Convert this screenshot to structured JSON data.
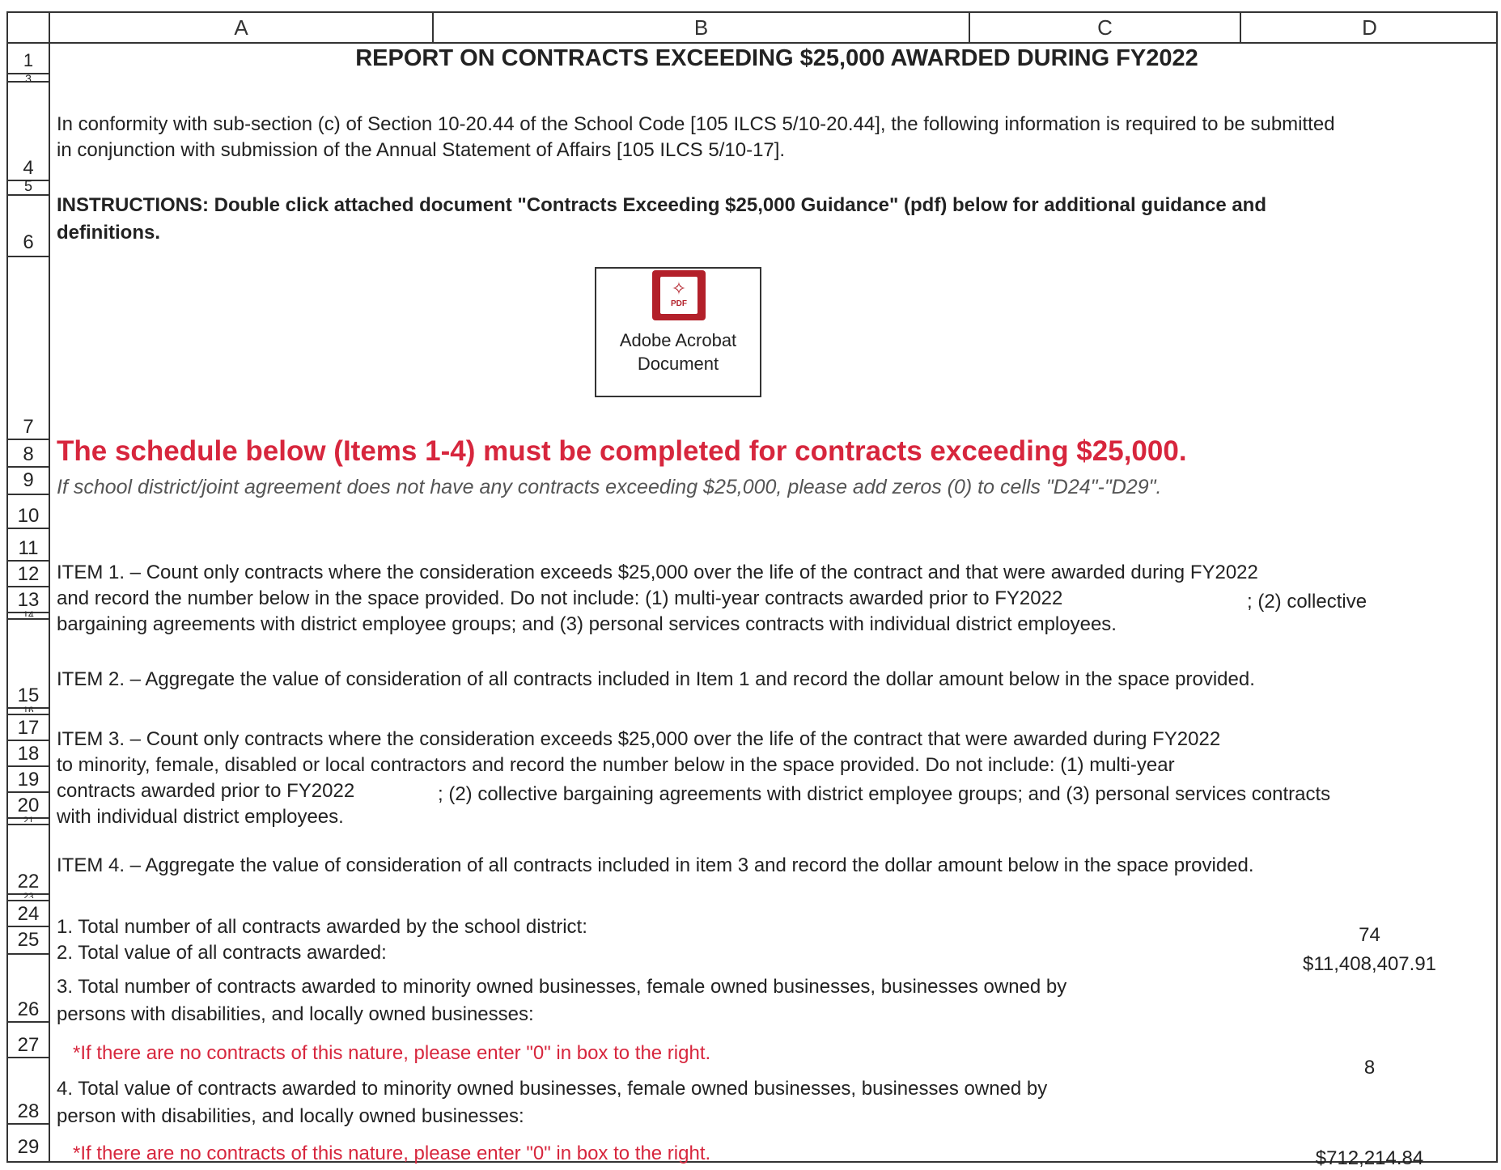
{
  "columns": {
    "a": "A",
    "b": "B",
    "c": "C",
    "d": "D"
  },
  "row_numbers": {
    "r1": "1",
    "r3": "3",
    "r4": "4",
    "r5": "5",
    "r6": "6",
    "r7": "7",
    "r8": "8",
    "r9": "9",
    "r10": "10",
    "r11": "11",
    "r12": "12",
    "r13": "13",
    "r14": "14",
    "r15": "15",
    "r16": "16",
    "r17": "17",
    "r18": "18",
    "r19": "19",
    "r20": "20",
    "r21": "21",
    "r22": "22",
    "r23": "23",
    "r24": "24",
    "r25": "25",
    "r26": "26",
    "r27": "27",
    "r28": "28",
    "r29": "29"
  },
  "title": "REPORT ON CONTRACTS EXCEEDING $25,000 AWARDED DURING FY2022",
  "conformity_line1": "In conformity with sub-section (c) of Section 10-20.44 of the School Code [105 ILCS 5/10-20.44], the following information is required to be submitted",
  "conformity_line2": "in conjunction with submission of the Annual Statement of Affairs [105 ILCS 5/10-17].",
  "instructions_line1": "INSTRUCTIONS:  Double click attached document \"Contracts Exceeding $25,000 Guidance\" (pdf) below for additional guidance and",
  "instructions_line2": "definitions.",
  "attachment": {
    "icon": "pdf-icon",
    "badge": "PDF",
    "caption_line1": "Adobe Acrobat",
    "caption_line2": "Document"
  },
  "schedule_heading": "The schedule below (Items 1-4) must be completed for contracts exceeding $25,000.",
  "schedule_note": "If school district/joint agreement does not have any contracts exceeding $25,000, please add zeros (0) to cells \"D24\"-\"D29\".",
  "item1_line1": "ITEM 1. – Count only contracts where the consideration exceeds $25,000 over the life of the contract and that were awarded during FY2022",
  "item1_line2": "and record the number below in the space provided. Do not include: (1) multi-year contracts awarded prior to FY2022",
  "item1_line2b": "; (2) collective",
  "item1_line3": "bargaining agreements with district employee groups; and (3) personal services contracts with individual district employees.",
  "item2": "ITEM 2. – Aggregate the value of consideration of all contracts included in Item 1 and record the dollar amount below in the space provided.",
  "item3_line1": "ITEM 3. – Count only contracts where the consideration exceeds $25,000 over the life of the contract that were awarded during FY2022",
  "item3_line2": "to minority, female, disabled or local contractors and record the number below in the space provided. Do not include: (1) multi-year",
  "item3_line3": "contracts awarded prior to FY2022",
  "item3_line3b": "; (2) collective bargaining agreements with district employee groups; and (3) personal services contracts",
  "item3_line4": "with individual district employees.",
  "item4": "ITEM 4. – Aggregate the value of consideration of all contracts included in item 3 and record the dollar amount below in the space provided.",
  "q1": "1.  Total number of all contracts awarded by the school district:",
  "q2": "2.  Total value of all contracts awarded:",
  "q3_line1": "3.  Total number of contracts awarded to minority owned businesses, female owned businesses, businesses owned by",
  "q3_line2": "persons with disabilities, and locally owned businesses:",
  "q3_note": "*If there are no contracts of this nature, please enter \"0\" in box to the right.",
  "q4_line1": "4.  Total value of contracts awarded to minority owned businesses, female owned businesses, businesses owned by",
  "q4_line2": "person with disabilities, and locally owned businesses:",
  "q4_note": "*If there are no contracts of this nature, please enter \"0\" in box to the right.",
  "values": {
    "d24": "74",
    "d25": "$11,408,407.91",
    "d27": "8",
    "d29": "$712,214.84"
  }
}
